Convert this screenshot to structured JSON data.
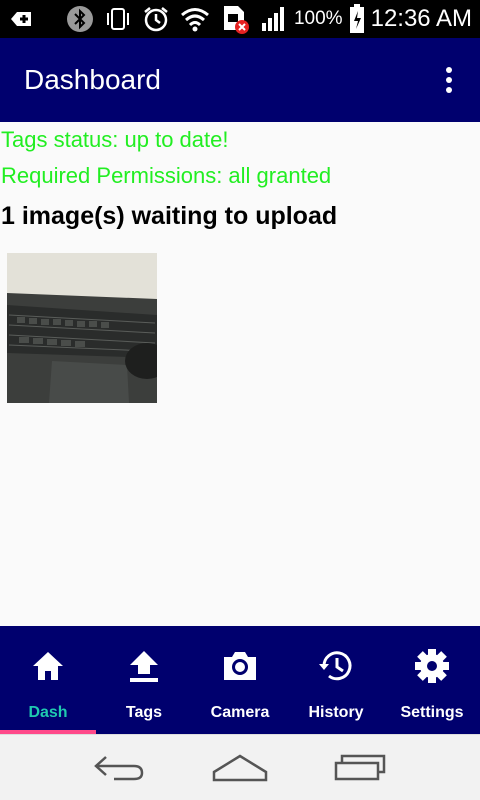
{
  "status_bar": {
    "battery_percent": "100%",
    "time": "12:36 AM",
    "icons": [
      "add-box-icon",
      "bluetooth-icon",
      "vibrate-icon",
      "alarm-icon",
      "wifi-icon",
      "sim-error-icon",
      "signal-icon",
      "battery-charging-icon"
    ]
  },
  "app_bar": {
    "title": "Dashboard",
    "menu_icon": "more-vert-icon"
  },
  "main": {
    "tags_status": "Tags status: up to date!",
    "permissions_status": "Required Permissions: all granted",
    "upload_heading": "1 image(s) waiting to upload",
    "status_color": "#22ee22"
  },
  "bottom_nav": {
    "items": [
      {
        "label": "Dash",
        "icon": "home-icon",
        "active": true
      },
      {
        "label": "Tags",
        "icon": "upload-icon",
        "active": false
      },
      {
        "label": "Camera",
        "icon": "camera-icon",
        "active": false
      },
      {
        "label": "History",
        "icon": "history-icon",
        "active": false
      },
      {
        "label": "Settings",
        "icon": "settings-icon",
        "active": false
      }
    ],
    "background": "#00006e",
    "active_color": "#1fc9b0",
    "indicator_color": "#ff4a8a"
  },
  "system_nav": {
    "buttons": [
      "back-icon",
      "home-outline-icon",
      "recents-icon"
    ]
  }
}
